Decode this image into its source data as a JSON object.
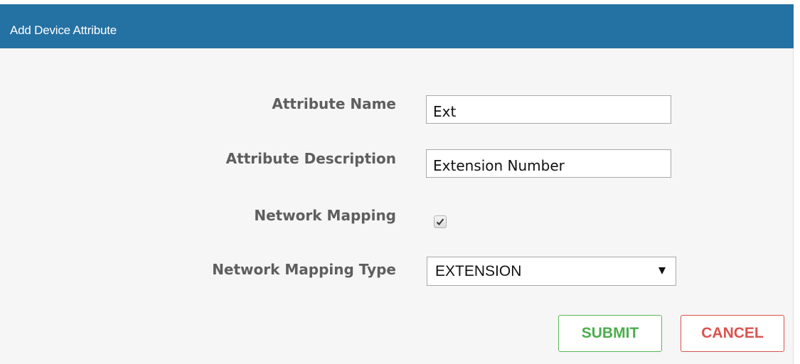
{
  "dialog": {
    "title": "Add Device Attribute",
    "header_color": "#2471a3"
  },
  "form": {
    "attribute_name": {
      "label": "Attribute Name",
      "value": "Ext"
    },
    "attribute_description": {
      "label": "Attribute Description",
      "value": "Extension Number"
    },
    "network_mapping": {
      "label": "Network Mapping",
      "checked": true
    },
    "network_mapping_type": {
      "label": "Network Mapping Type",
      "selected": "EXTENSION"
    }
  },
  "buttons": {
    "submit_label": "SUBMIT",
    "submit_color": "#5cb85c",
    "cancel_label": "CANCEL",
    "cancel_color": "#d9534f"
  },
  "icons": {
    "checkmark": "check-icon",
    "dropdown": "triangle-down-icon"
  }
}
